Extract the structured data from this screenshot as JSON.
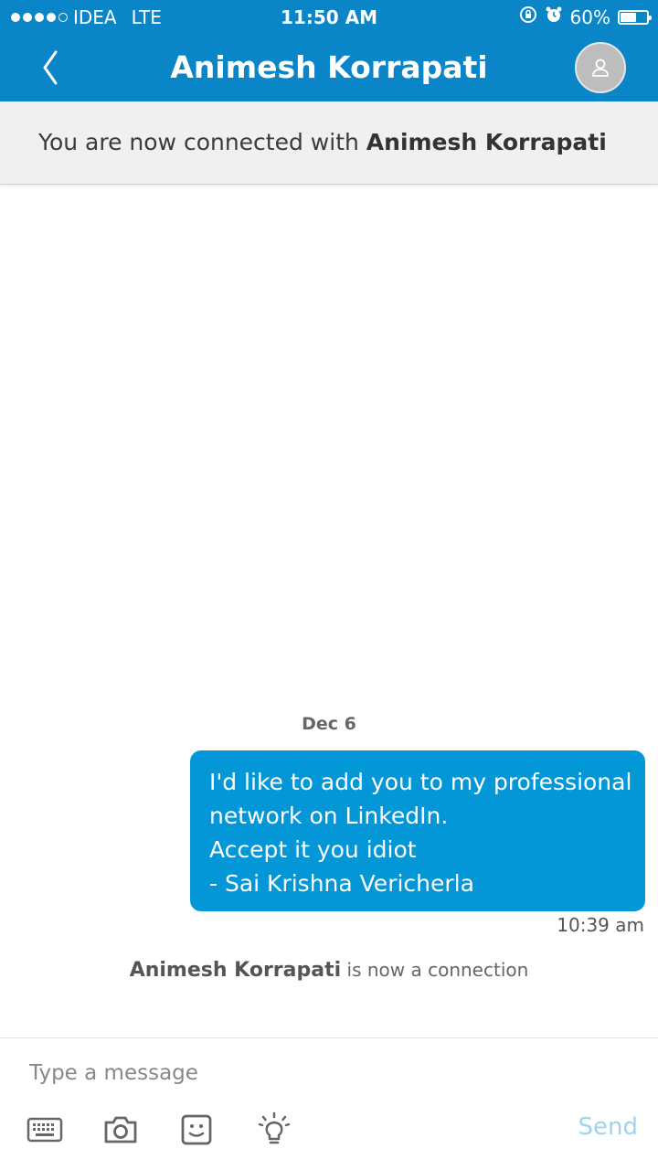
{
  "status_bar": {
    "carrier": "IDEA",
    "network": "LTE",
    "time": "11:50 AM",
    "battery_percent": "60%",
    "battery_level": 0.6,
    "signal_bars_filled": 4,
    "signal_bars_total": 5
  },
  "nav": {
    "title": "Animesh Korrapati",
    "back_icon": "chevron-left-icon",
    "avatar_icon": "person-icon"
  },
  "banner": {
    "prefix": "You are now connected with ",
    "name": "Animesh Korrapati"
  },
  "conversation": {
    "date": "Dec 6",
    "message": {
      "lines": [
        "I'd like to add you to my professional",
        "network on LinkedIn.",
        "Accept it you idiot",
        "- Sai Krishna Vericherla"
      ],
      "time": "10:39 am"
    },
    "connection_note": {
      "name": "Animesh Korrapati",
      "suffix": " is now a connection"
    }
  },
  "composer": {
    "placeholder": "Type a message",
    "value": "",
    "send_label": "Send",
    "tools": [
      "keyboard-icon",
      "camera-icon",
      "emoji-icon",
      "lightbulb-icon"
    ]
  },
  "colors": {
    "header": "#0a86c8",
    "bubble": "#0397d8",
    "send_disabled": "#9fd3ee"
  }
}
